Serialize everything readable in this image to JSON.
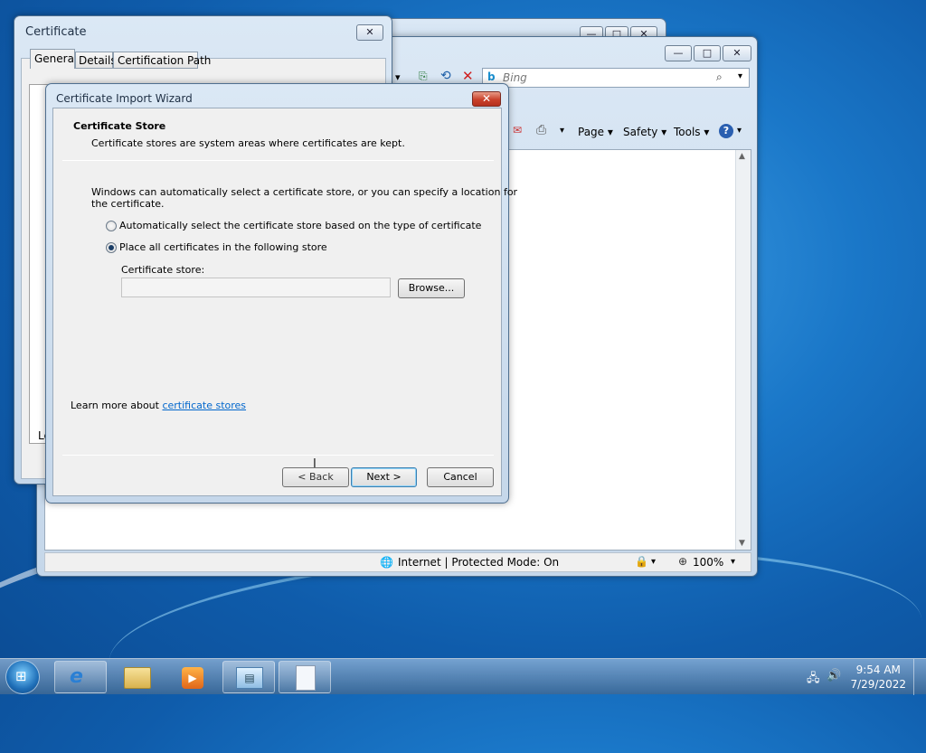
{
  "ie": {
    "search_placeholder": "Bing",
    "command_bar": {
      "page": "Page ▾",
      "safety": "Safety ▾",
      "tools": "Tools ▾"
    },
    "status": {
      "zone": "Internet | Protected Mode: On",
      "zoom": "100%"
    }
  },
  "cert_window": {
    "title": "Certificate",
    "tabs": [
      "General",
      "Details",
      "Certification Path"
    ]
  },
  "wizard": {
    "title": "Certificate Import Wizard",
    "heading": "Certificate Store",
    "subheading": "Certificate stores are system areas where certificates are kept.",
    "description_line1": "Windows can automatically select a certificate store, or you can specify a location for",
    "description_line2": "the certificate.",
    "option_auto": "Automatically select the certificate store based on the type of certificate",
    "option_manual": "Place all certificates in the following store",
    "store_label": "Certificate store:",
    "store_value": "",
    "browse": "Browse...",
    "learn_more_prefix": "Learn more about ",
    "learn_more_link": "certificate stores",
    "back": "< Back",
    "next": "Next >",
    "cancel": "Cancel",
    "selected_option": "manual"
  },
  "taskbar": {
    "time": "9:54 AM",
    "date": "7/29/2022"
  }
}
